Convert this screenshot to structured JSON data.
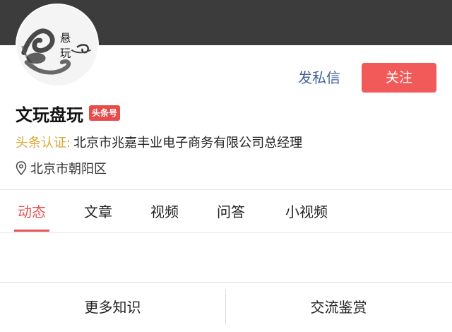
{
  "profile": {
    "avatar_text": "悬玩",
    "name": "文玩盘玩",
    "badge": "头条号",
    "verify_label": "头条认证:",
    "verify_text": "北京市兆嘉丰业电子商务有限公司总经理",
    "location": "北京市朝阳区"
  },
  "actions": {
    "message_label": "发私信",
    "follow_label": "关注"
  },
  "tabs": [
    {
      "label": "动态",
      "active": true
    },
    {
      "label": "文章",
      "active": false
    },
    {
      "label": "视频",
      "active": false
    },
    {
      "label": "问答",
      "active": false
    },
    {
      "label": "小视频",
      "active": false
    }
  ],
  "bottom_menu": [
    {
      "label": "更多知识"
    },
    {
      "label": "交流鉴赏"
    }
  ],
  "colors": {
    "header": "#3c3c3c",
    "accent_red": "#f25a5a",
    "link_blue": "#406599",
    "verify_gold": "#dba73a"
  },
  "icons": {
    "location": "map-pin-icon"
  }
}
